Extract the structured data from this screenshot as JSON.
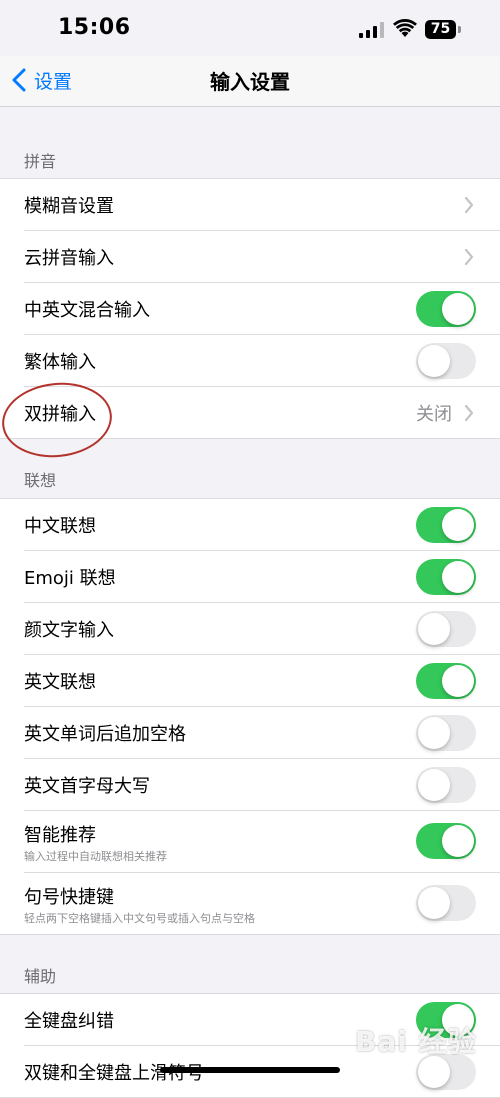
{
  "status": {
    "time": "15:06",
    "battery": "75"
  },
  "nav": {
    "back_label": "设置",
    "title": "输入设置"
  },
  "pinyin": {
    "header": "拼音",
    "rows": [
      {
        "label": "模糊音设置"
      },
      {
        "label": "云拼音输入"
      },
      {
        "label": "中英文混合输入",
        "toggle": true
      },
      {
        "label": "繁体输入",
        "toggle": false
      },
      {
        "label": "双拼输入",
        "value": "关闭"
      }
    ]
  },
  "lianxiang": {
    "header": "联想",
    "rows": [
      {
        "label": "中文联想",
        "toggle": true
      },
      {
        "label": "Emoji 联想",
        "toggle": true
      },
      {
        "label": "颜文字输入",
        "toggle": false
      },
      {
        "label": "英文联想",
        "toggle": true
      },
      {
        "label": "英文单词后追加空格",
        "toggle": false
      },
      {
        "label": "英文首字母大写",
        "toggle": false
      },
      {
        "label": "智能推荐",
        "sub": "输入过程中自动联想相关推荐",
        "toggle": true
      },
      {
        "label": "句号快捷键",
        "sub": "轻点两下空格键插入中文句号或插入句点与空格",
        "toggle": false
      }
    ]
  },
  "fuzhu": {
    "header": "辅助",
    "rows": [
      {
        "label": "全键盘纠错",
        "toggle": true
      },
      {
        "label": "双键和全键盘上滑符号",
        "toggle": false
      }
    ]
  },
  "watermark": "Bai 经验",
  "colors": {
    "accent": "#007aff",
    "toggle_on": "#34c759",
    "annotation": "#b4322c"
  }
}
